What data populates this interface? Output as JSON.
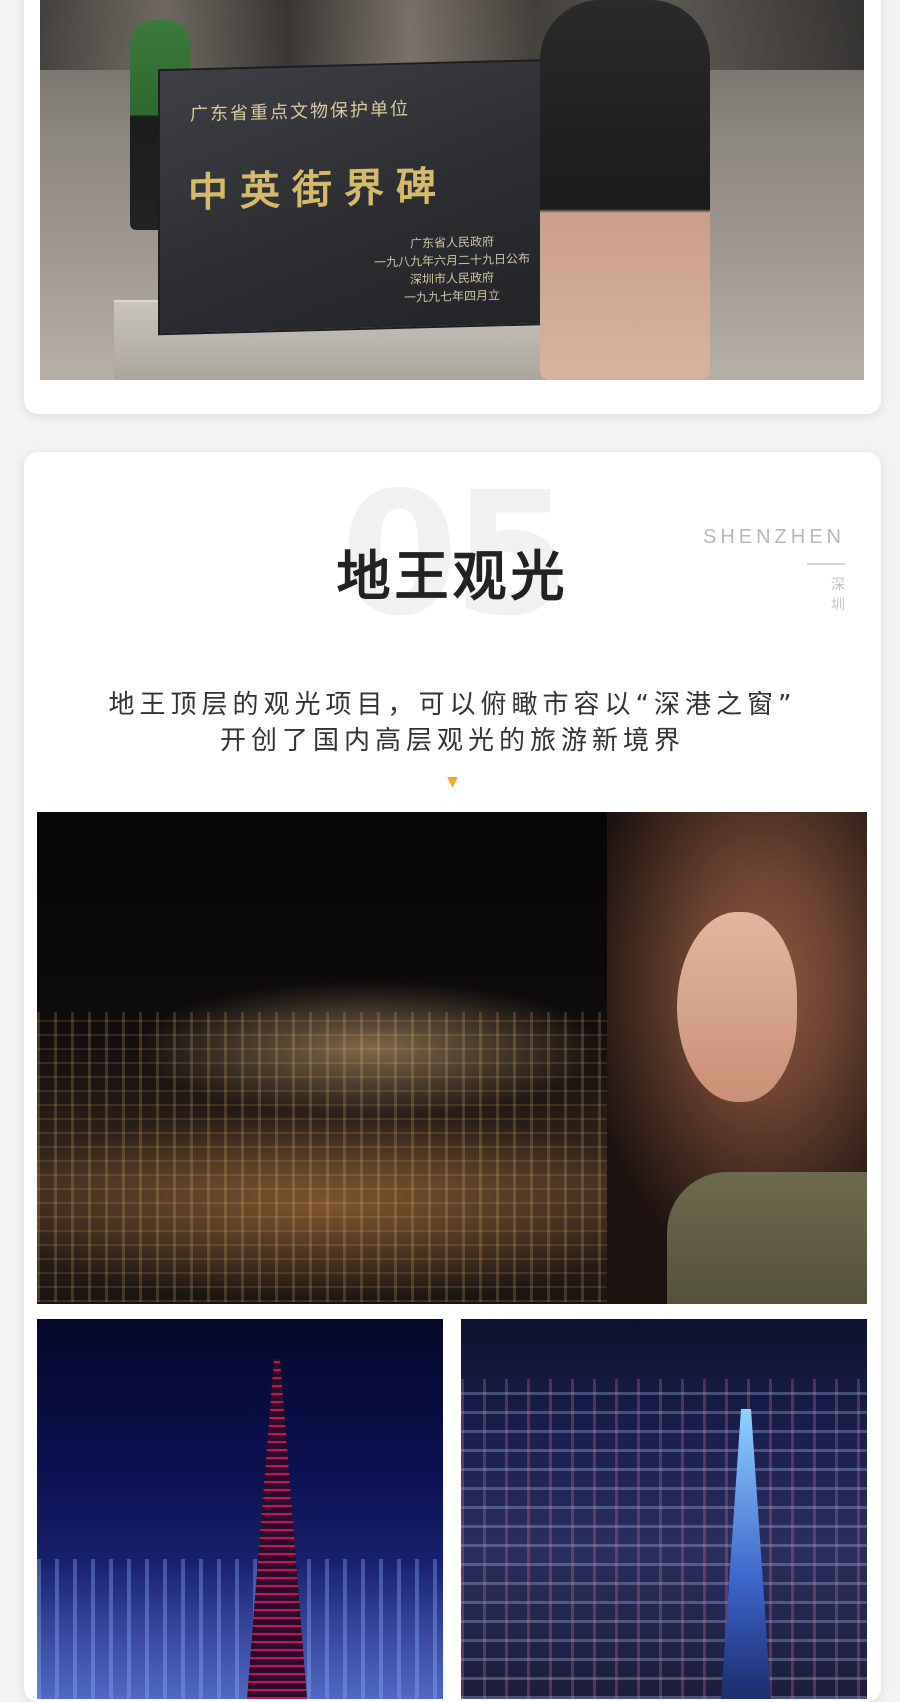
{
  "section1": {
    "stele": {
      "org": "广东省重点文物保护单位",
      "main": "中英街界碑",
      "line1": "广东省人民政府",
      "line2": "一九八九年六月二十九日公布",
      "line3": "深圳市人民政府",
      "line4": "一九九七年四月立"
    }
  },
  "section2": {
    "number": "05",
    "title": "地王观光",
    "side_en": "SHENZHEN",
    "side_zh_1": "深",
    "side_zh_2": "圳",
    "desc_line1": "地王顶层的观光项目，可以俯瞰市容以“深港之窗”",
    "desc_line2": "开创了国内高层观光的旅游新境界",
    "arrow": "▼"
  },
  "colors": {
    "accent": "#f5a623",
    "title": "#222222",
    "muted": "#b8b8b8"
  }
}
